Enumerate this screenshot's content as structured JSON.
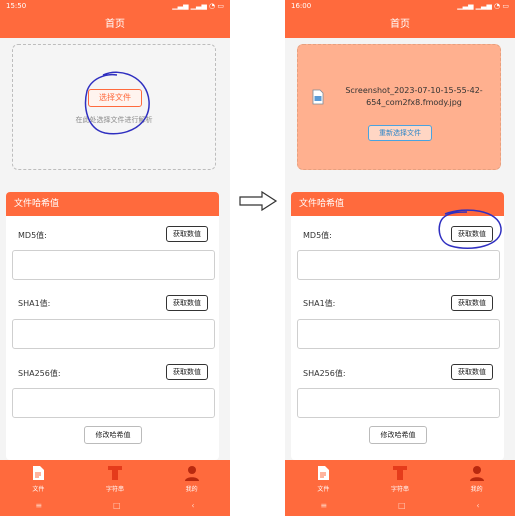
{
  "left": {
    "status_time": "15:50",
    "status_icons": "▁▃▅ ▁▃▅ ◔ ▭",
    "header_title": "首页",
    "upload": {
      "choose_label": "选择文件",
      "hint": "在此处选择文件进行解析"
    },
    "card": {
      "title": "文件哈希值",
      "md5_label": "MD5值:",
      "sha1_label": "SHA1值:",
      "sha256_label": "SHA256值:",
      "get_label": "获取数值",
      "modify_label": "修改哈希值"
    },
    "tabs": [
      {
        "label": "文件"
      },
      {
        "label": "字符串"
      },
      {
        "label": "我的"
      }
    ],
    "nav": {
      "menu": "≡",
      "home": "□",
      "back": "‹"
    }
  },
  "right": {
    "status_time": "16:00",
    "status_icons": "▁▃▅ ▁▃▅ ◔ ▭",
    "header_title": "首页",
    "upload": {
      "file_name": "Screenshot_2023-07-10-15-55-42-654_com2fx8.fmody.jpg",
      "rechoose_label": "重新选择文件"
    },
    "card": {
      "title": "文件哈希值",
      "md5_label": "MD5值:",
      "sha1_label": "SHA1值:",
      "sha256_label": "SHA256值:",
      "get_label": "获取数值",
      "modify_label": "修改哈希值"
    },
    "tabs": [
      {
        "label": "文件"
      },
      {
        "label": "字符串"
      },
      {
        "label": "我的"
      }
    ],
    "nav": {
      "menu": "≡",
      "home": "□",
      "back": "‹"
    }
  },
  "colors": {
    "accent": "#ff6a3d",
    "annotation": "#2f2fc0"
  }
}
